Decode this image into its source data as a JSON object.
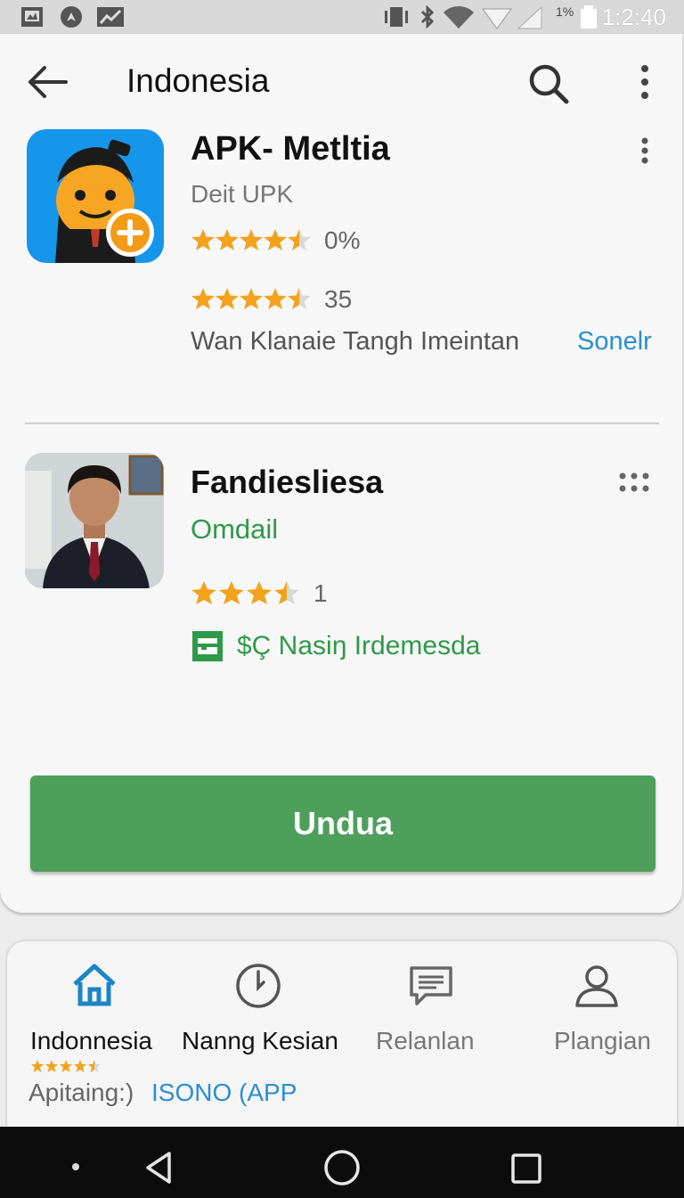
{
  "status_bar": {
    "battery_percent": "1%",
    "time": "1:2:40"
  },
  "app_bar": {
    "title": "Indonesia"
  },
  "app_listing_1": {
    "title": "APK- Metltia",
    "developer": "Deit UPK",
    "rating_1": {
      "stars": 4.5,
      "value": "0%"
    },
    "rating_2": {
      "stars": 4.5,
      "value": "35"
    },
    "description": "Wan Klanaie Tangh Imeintan",
    "link": "Sonelr"
  },
  "app_listing_2": {
    "title": "Fandiesliesa",
    "subtitle": "Omdail",
    "rating": {
      "stars": 3.5,
      "value": "1"
    },
    "tag": "$Ç Nasiŋ Irdemesda"
  },
  "install_button": {
    "label": "Undua"
  },
  "bottom_nav": {
    "items": [
      {
        "label": "Indonnesia",
        "icon": "home-icon",
        "active": true
      },
      {
        "label": "Nanng Kesian",
        "icon": "clock-icon",
        "active": false
      },
      {
        "label": "Relanlan",
        "icon": "chat-icon",
        "active": false
      },
      {
        "label": "Plangian",
        "icon": "person-icon",
        "active": false
      }
    ],
    "mini_rating_stars": 4.5,
    "footer_text": "Apitaing:)",
    "footer_link": "ISONO (APP"
  },
  "colors": {
    "accent_green": "#4e9f5c",
    "link_blue": "#2a8fd0",
    "star_orange": "#f3a21c",
    "active_nav_blue": "#1a86c8"
  }
}
